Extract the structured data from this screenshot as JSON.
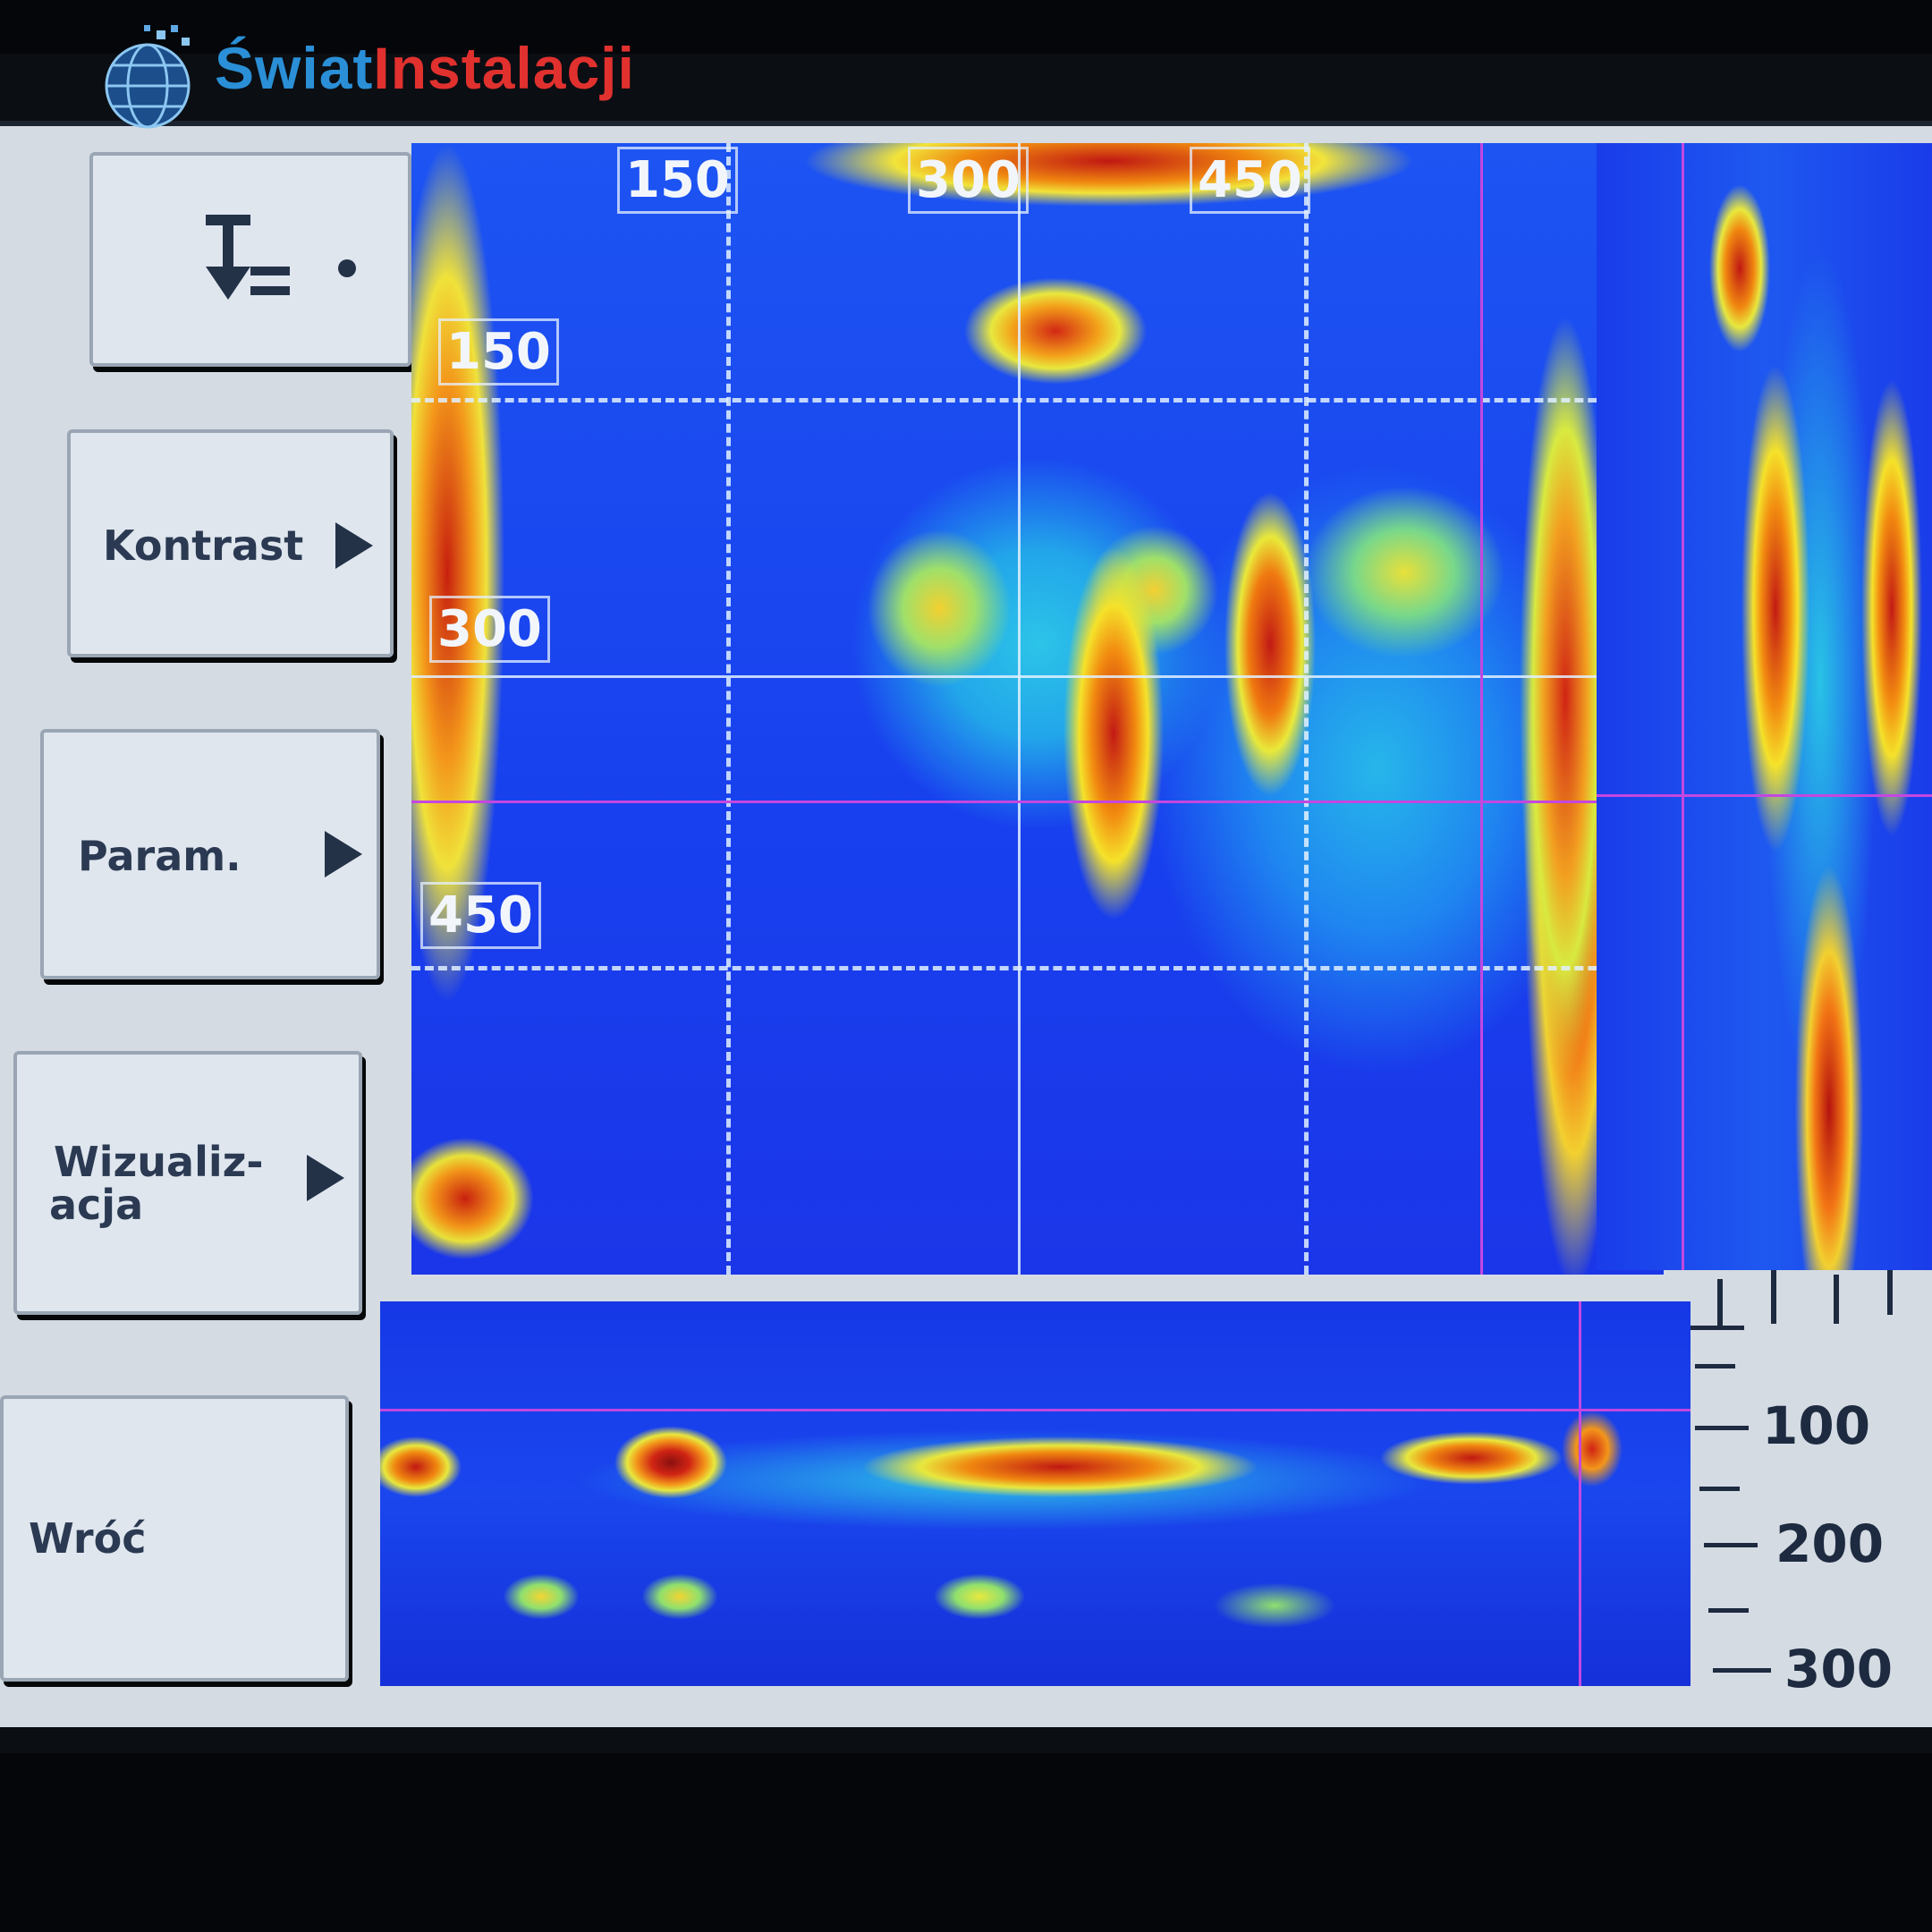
{
  "logo": {
    "part1": "Świat",
    "part2": "Instalacji"
  },
  "sidebar": {
    "items": [
      {
        "label": "",
        "icon": "depth-level-icon"
      },
      {
        "label": "Kontrast",
        "icon": "play-arrow-icon"
      },
      {
        "label": "Param.",
        "icon": "play-arrow-icon"
      },
      {
        "label": "Wizualiz-\nacja",
        "label_line1": "Wizualiz-",
        "label_line2": "acja",
        "icon": "play-arrow-icon"
      },
      {
        "label": "Wróć"
      }
    ]
  },
  "main_map": {
    "x_scale_labels": [
      "150",
      "300",
      "450"
    ],
    "y_scale_labels": [
      "150",
      "300",
      "450"
    ]
  },
  "depth_scale": {
    "labels": [
      "100",
      "200",
      "300"
    ]
  },
  "colors": {
    "cursor": "#c447e0",
    "low": "#1a40ee",
    "mid": "#2cc4e8",
    "high": "#f2d030",
    "peak": "#c21a14"
  }
}
